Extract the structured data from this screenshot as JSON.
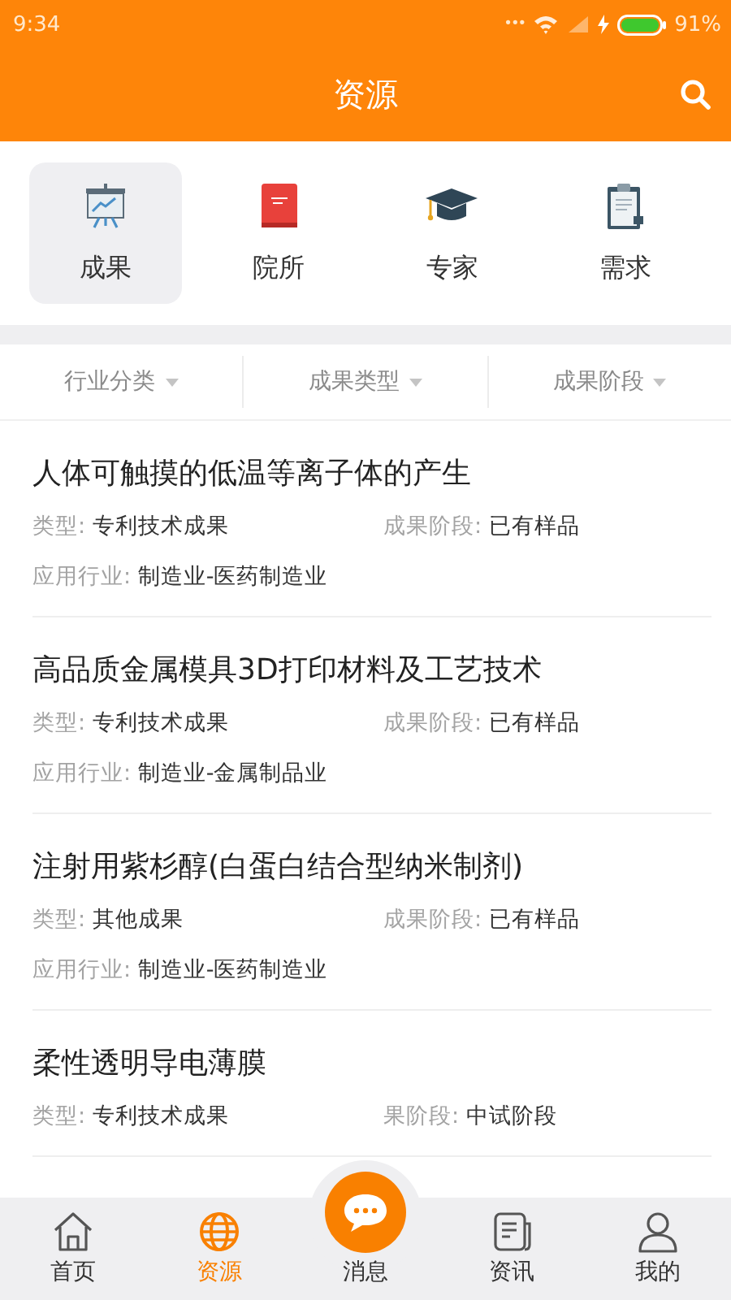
{
  "status_bar": {
    "time": "9:34",
    "dots": "•••",
    "battery_text": "91%"
  },
  "header": {
    "title": "资源"
  },
  "categories": [
    {
      "label": "成果",
      "selected": true
    },
    {
      "label": "院所",
      "selected": false
    },
    {
      "label": "专家",
      "selected": false
    },
    {
      "label": "需求",
      "selected": false
    }
  ],
  "filters": [
    {
      "label": "行业分类"
    },
    {
      "label": "成果类型"
    },
    {
      "label": "成果阶段"
    }
  ],
  "results": [
    {
      "title": "人体可触摸的低温等离子体的产生",
      "fields": [
        {
          "label": "类型:",
          "value": "专利技术成果"
        },
        {
          "label": "成果阶段:",
          "value": "已有样品"
        },
        {
          "label": "应用行业:",
          "value": "制造业-医药制造业"
        }
      ]
    },
    {
      "title": "高品质金属模具3D打印材料及工艺技术",
      "fields": [
        {
          "label": "类型:",
          "value": "专利技术成果"
        },
        {
          "label": "成果阶段:",
          "value": "已有样品"
        },
        {
          "label": "应用行业:",
          "value": "制造业-金属制品业"
        }
      ]
    },
    {
      "title": "注射用紫杉醇(白蛋白结合型纳米制剂)",
      "fields": [
        {
          "label": "类型:",
          "value": "其他成果"
        },
        {
          "label": "成果阶段:",
          "value": "已有样品"
        },
        {
          "label": "应用行业:",
          "value": "制造业-医药制造业"
        }
      ]
    },
    {
      "title": "柔性透明导电薄膜",
      "fields": [
        {
          "label": "类型:",
          "value": "专利技术成果"
        },
        {
          "label": "果阶段:",
          "value": "中试阶段"
        }
      ]
    }
  ],
  "tab_bar": [
    {
      "label": "首页",
      "selected": false
    },
    {
      "label": "资源",
      "selected": true
    },
    {
      "label": "消息",
      "selected": false
    },
    {
      "label": "资讯",
      "selected": false
    },
    {
      "label": "我的",
      "selected": false
    }
  ]
}
